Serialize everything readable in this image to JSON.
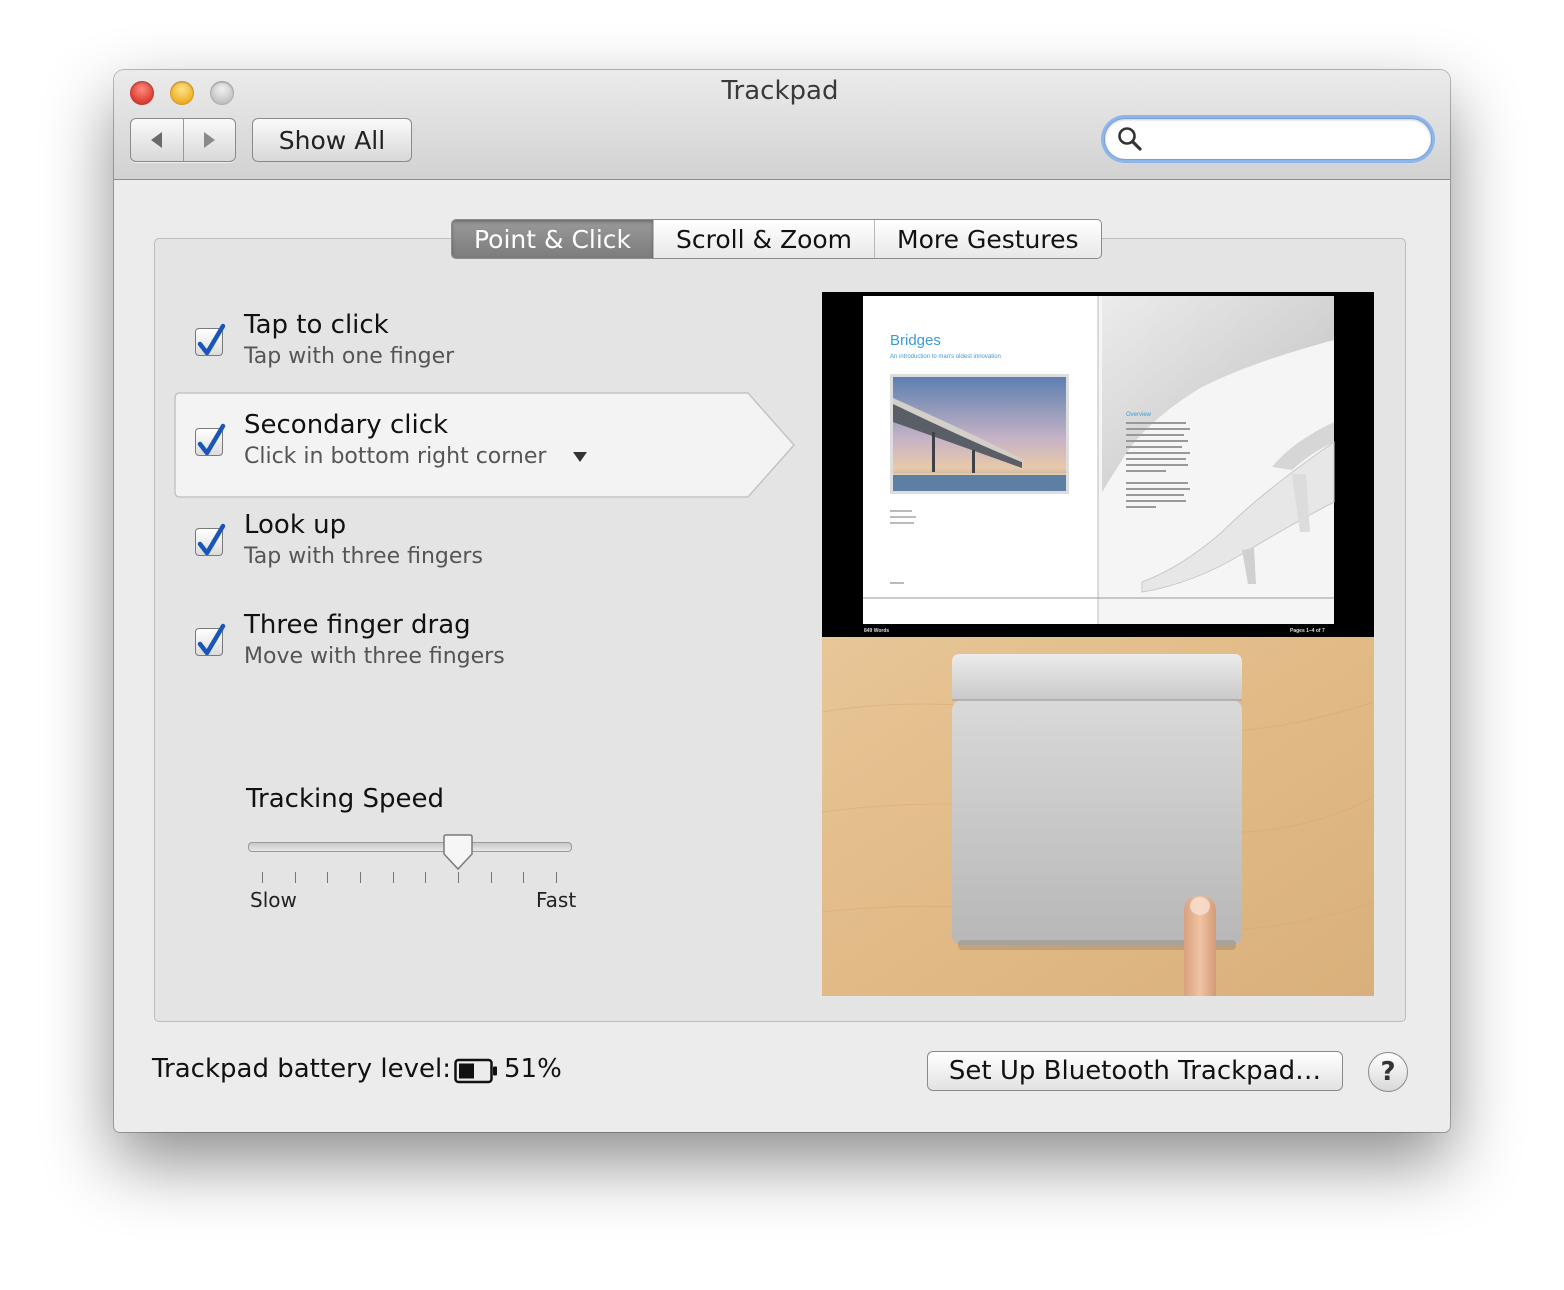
{
  "window": {
    "title": "Trackpad"
  },
  "toolbar": {
    "back_icon": "chevron-left-icon",
    "forward_icon": "chevron-right-icon",
    "show_all_label": "Show All",
    "search_placeholder": "",
    "search_value": ""
  },
  "tabs": [
    {
      "label": "Point & Click",
      "active": true
    },
    {
      "label": "Scroll & Zoom",
      "active": false
    },
    {
      "label": "More Gestures",
      "active": false
    }
  ],
  "options": [
    {
      "title": "Tap to click",
      "subtitle": "Tap with one finger",
      "checked": true
    },
    {
      "title": "Secondary click",
      "subtitle": "Click in bottom right corner",
      "checked": true,
      "selected": true,
      "has_dropdown": true
    },
    {
      "title": "Look up",
      "subtitle": "Tap with three fingers",
      "checked": true
    },
    {
      "title": "Three finger drag",
      "subtitle": "Move with three fingers",
      "checked": true
    }
  ],
  "tracking_speed": {
    "label": "Tracking Speed",
    "min_label": "Slow",
    "max_label": "Fast",
    "tick_count": 10,
    "value_fraction": 0.67
  },
  "preview": {
    "book_title": "Bridges",
    "book_subtitle": "An introduction to man's oldest innovation",
    "section_heading": "Overview",
    "footer_left": "849 Words",
    "footer_right": "Pages 1–4 of 7"
  },
  "footer": {
    "battery_label": "Trackpad battery level:",
    "battery_percent": "51%",
    "battery_level": 0.51,
    "bluetooth_button": "Set Up Bluetooth Trackpad…",
    "help_label": "?"
  },
  "colors": {
    "accent_focus": "#8db6ec",
    "check_blue": "#1a56b8",
    "active_tab": "#8a8a8a",
    "book_title_blue": "#3a9ad9",
    "wood": "#e3c08e"
  }
}
